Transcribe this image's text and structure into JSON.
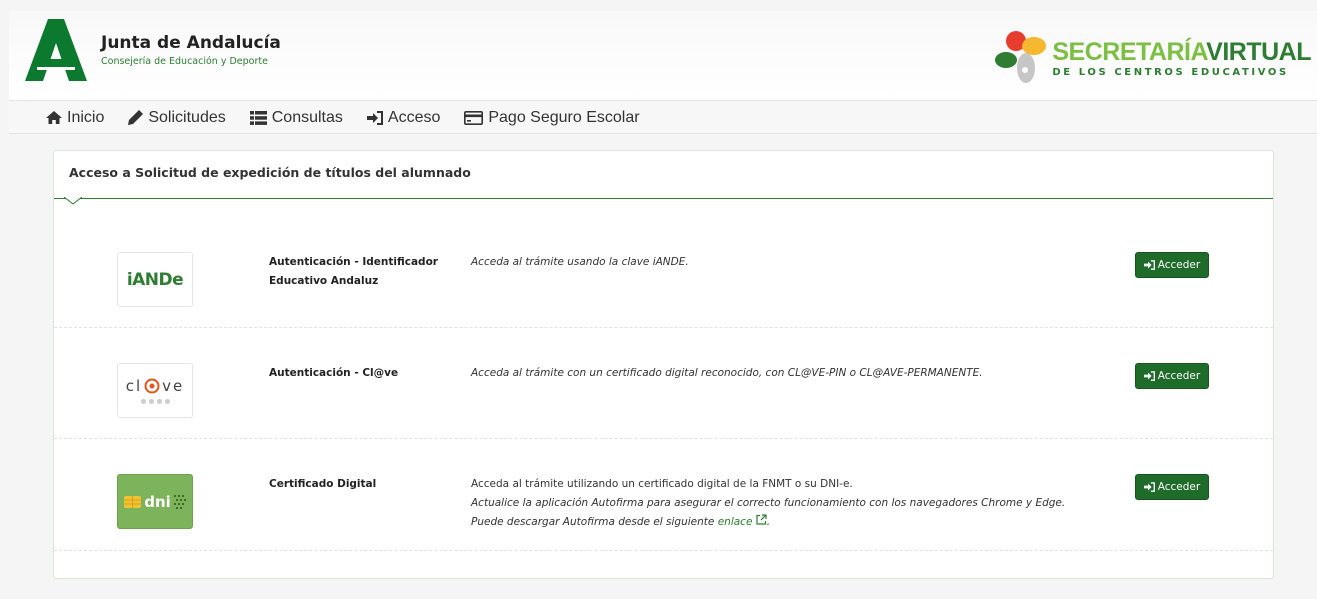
{
  "header": {
    "brand_title": "Junta de Andalucía",
    "brand_subtitle": "Consejería de Educación y Deporte",
    "sv_line1_a": "SECRETARÍA",
    "sv_line1_b": "VIRTUAL",
    "sv_line2": "DE LOS CENTROS EDUCATIVOS"
  },
  "nav": {
    "items": [
      {
        "label": "Inicio",
        "icon": "home-icon"
      },
      {
        "label": "Solicitudes",
        "icon": "pencil-icon"
      },
      {
        "label": "Consultas",
        "icon": "list-icon"
      },
      {
        "label": "Acceso",
        "icon": "sign-in-icon"
      },
      {
        "label": "Pago Seguro Escolar",
        "icon": "credit-card-icon"
      }
    ]
  },
  "panel": {
    "title": "Acceso a Solicitud de expedición de títulos del alumnado",
    "methods": [
      {
        "logo_text": "iANDe",
        "name": "Autenticación - Identificador Educativo Andaluz",
        "description": "Acceda al trámite usando la clave iANDE.",
        "button": "Acceder"
      },
      {
        "logo_text_a": "cl",
        "logo_text_b": "ve",
        "name": "Autenticación - Cl@ve",
        "description": "Acceda al trámite con un certificado digital reconocido, con CL@VE-PIN o CL@AVE-PERMANENTE.",
        "button": "Acceder"
      },
      {
        "logo_text": "dni",
        "name": "Certificado Digital",
        "description_line1": "Acceda al trámite utilizando un certificado digital de la FNMT o su DNI-e.",
        "description_line2": "Actualice la aplicación Autofirma para asegurar el correcto funcionamiento con los navegadores Chrome y Edge.",
        "description_line3_prefix": "Puede descargar Autofirma desde el siguiente",
        "link_text": "enlace",
        "description_line3_suffix": ".",
        "button": "Acceder"
      }
    ]
  },
  "colors": {
    "brand_green": "#2e7d32",
    "light_green": "#7cbf45",
    "button_green": "#1e6b2a"
  }
}
